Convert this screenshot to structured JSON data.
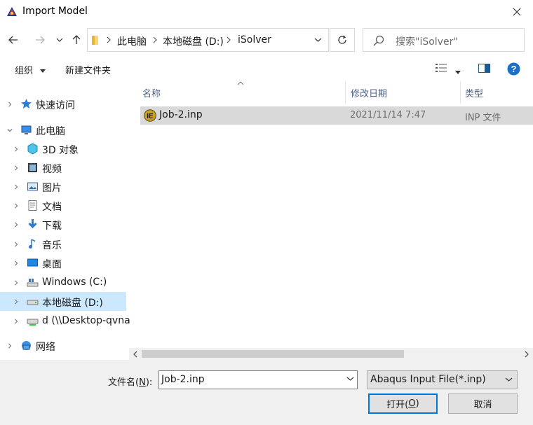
{
  "window": {
    "title": "Import Model"
  },
  "address": {
    "breadcrumb": [
      "此电脑",
      "本地磁盘 (D:)",
      "iSolver"
    ],
    "search_placeholder": "搜索\"iSolver\""
  },
  "toolbar": {
    "organize_label": "组织",
    "new_folder_label": "新建文件夹"
  },
  "tree": {
    "items": [
      {
        "label": "快速访问",
        "icon": "star-icon"
      },
      {
        "label": "此电脑",
        "icon": "computer-icon"
      },
      {
        "label": "3D 对象",
        "icon": "3d-objects-icon"
      },
      {
        "label": "视频",
        "icon": "video-icon"
      },
      {
        "label": "图片",
        "icon": "pictures-icon"
      },
      {
        "label": "文档",
        "icon": "documents-icon"
      },
      {
        "label": "下载",
        "icon": "download-icon"
      },
      {
        "label": "音乐",
        "icon": "music-icon"
      },
      {
        "label": "桌面",
        "icon": "desktop-icon"
      },
      {
        "label": "Windows (C:)",
        "icon": "windows-drive-icon"
      },
      {
        "label": "本地磁盘 (D:)",
        "icon": "drive-icon"
      },
      {
        "label": "d (\\\\Desktop-qvna",
        "icon": "network-drive-icon"
      },
      {
        "label": "网络",
        "icon": "network-icon"
      }
    ]
  },
  "columns": {
    "name": "名称",
    "date": "修改日期",
    "type": "类型"
  },
  "files": [
    {
      "name": "Job-2.inp",
      "date": "2021/11/14 7:47",
      "type": "INP 文件"
    }
  ],
  "footer": {
    "filename_label": "文件名(",
    "filename_hotkey": "N",
    "filename_label_end": "):",
    "filename_value": "Job-2.inp",
    "filter_value": "Abaqus Input File(*.inp)",
    "open_label": "打开(",
    "open_hotkey": "O",
    "open_label_end": ")",
    "cancel_label": "取消"
  },
  "colors": {
    "accent": "#0078d7",
    "selection": "#cce8ff",
    "row_selected": "#d9d9d9"
  }
}
